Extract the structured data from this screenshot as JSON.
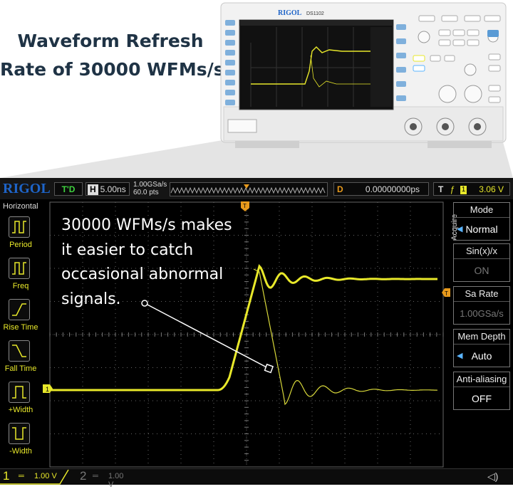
{
  "headline": {
    "line1": "Waveform Refresh",
    "line2": "Rate of 30000 WFMs/s"
  },
  "device": {
    "brand": "RIGOL",
    "model": "DS1102"
  },
  "scope": {
    "logo": "RIGOL",
    "trigger_status": "T'D",
    "timebase_letter": "H",
    "timebase": "5.00ns",
    "sample_rate": "1.00GSa/s",
    "points": "60.0 pts",
    "delay_letter": "D",
    "delay": "0.00000000ps",
    "trigger_letter": "T",
    "trigger_source": "1",
    "trigger_level": "3.06 V"
  },
  "left_menu": {
    "title": "Horizontal",
    "items": [
      {
        "label": "Period",
        "icon": "period-icon"
      },
      {
        "label": "Freq",
        "icon": "freq-icon"
      },
      {
        "label": "Rise Time",
        "icon": "rise-time-icon"
      },
      {
        "label": "Fall Time",
        "icon": "fall-time-icon"
      },
      {
        "label": "+Width",
        "icon": "positive-width-icon"
      },
      {
        "label": "-Width",
        "icon": "negative-width-icon"
      }
    ]
  },
  "right_menu": {
    "title": "Acquire",
    "mode_title": "Mode",
    "mode_value": "Normal",
    "sinx_title": "Sin(x)/x",
    "sinx_value": "ON",
    "sarate_title": "Sa Rate",
    "sarate_value": "1.00GSa/s",
    "memdepth_title": "Mem Depth",
    "memdepth_value": "Auto",
    "antialias_title": "Anti-aliasing",
    "antialias_value": "OFF"
  },
  "status": {
    "ch1_num": "1",
    "ch1_volts": "1.00 V",
    "ch2_num": "2",
    "ch2_volts": "1.00 V"
  },
  "markers": {
    "ch1": "1",
    "trigger": "T"
  },
  "annotation": {
    "line1": "30000 WFMs/s makes",
    "line2": "it easier to catch",
    "line3": "occasional abnormal",
    "line4": "signals."
  },
  "colors": {
    "ch1": "#e8e82a",
    "trigger": "#e89a1c",
    "logo": "#1e64c8",
    "headline": "#1f3345"
  }
}
